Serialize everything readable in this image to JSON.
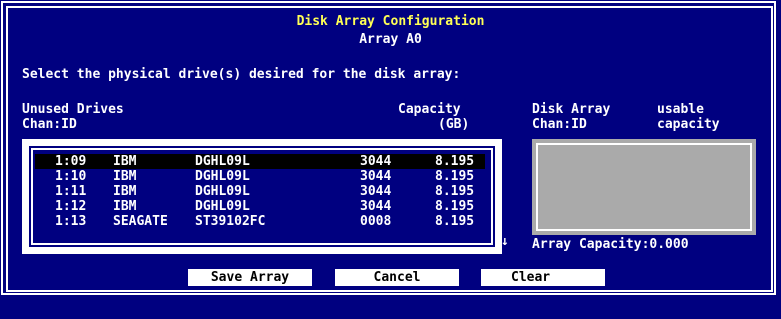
{
  "dialog": {
    "title": "Disk Array Configuration",
    "subtitle": "Array A0",
    "instruction": "Select the physical drive(s) desired for the disk array:"
  },
  "unused": {
    "header_line1": "Unused Drives",
    "header_line2": "Chan:ID",
    "capacity_line1": "Capacity",
    "capacity_line2": "(GB)",
    "drives": [
      {
        "chan_id": "1:09",
        "vendor": "IBM",
        "model": "DGHL09L",
        "rev": "3044",
        "capacity": "8.195"
      },
      {
        "chan_id": "1:10",
        "vendor": "IBM",
        "model": "DGHL09L",
        "rev": "3044",
        "capacity": "8.195"
      },
      {
        "chan_id": "1:11",
        "vendor": "IBM",
        "model": "DGHL09L",
        "rev": "3044",
        "capacity": "8.195"
      },
      {
        "chan_id": "1:12",
        "vendor": "IBM",
        "model": "DGHL09L",
        "rev": "3044",
        "capacity": "8.195"
      },
      {
        "chan_id": "1:13",
        "vendor": "SEAGATE",
        "model": "ST39102FC",
        "rev": "0008",
        "capacity": "8.195"
      }
    ],
    "scroll_arrow": "↓"
  },
  "array": {
    "header_line1": "Disk Array",
    "header_line2": "Chan:ID",
    "usable_line1": "usable",
    "usable_line2": "capacity",
    "capacity_label": "Array Capacity:0.000"
  },
  "buttons": {
    "save": "Save Array",
    "cancel": "Cancel",
    "clear": "Clear"
  },
  "colors": {
    "background": "#000080",
    "title": "#ffff55",
    "text": "#ffffff",
    "panel": "#aaaaaa"
  }
}
